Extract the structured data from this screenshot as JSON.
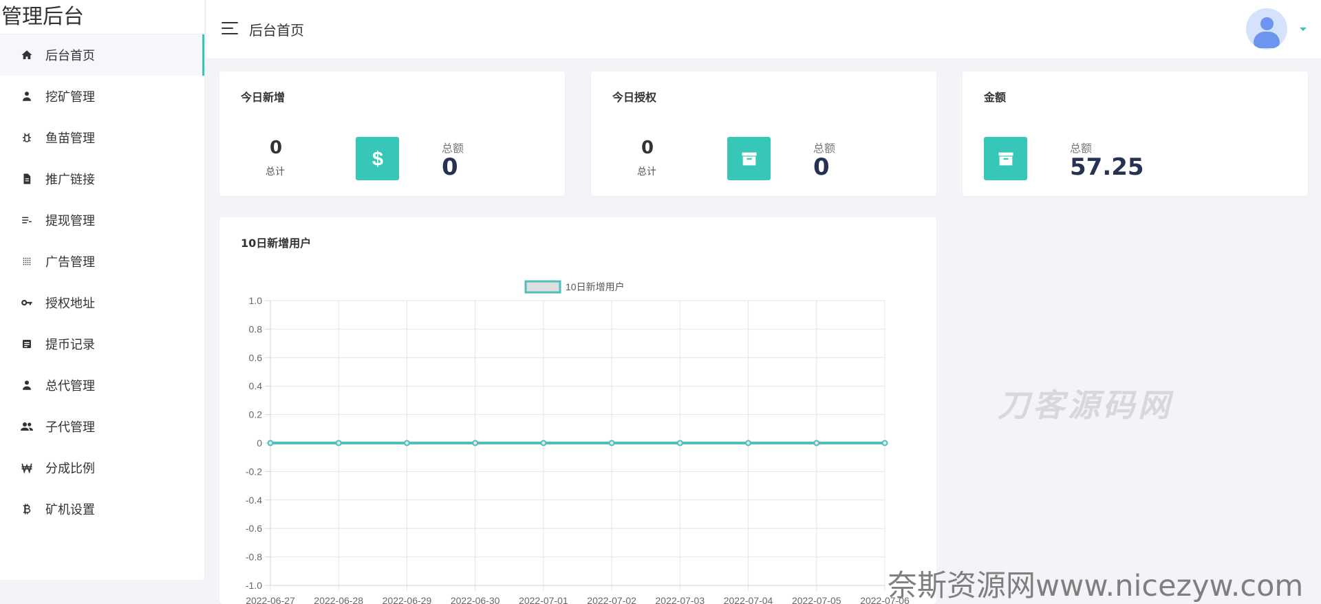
{
  "app": {
    "brand": "管理后台",
    "accent_color": "#38c5b8"
  },
  "sidebar": {
    "items": [
      {
        "label": "后台首页",
        "icon": "home-icon",
        "active": true
      },
      {
        "label": "挖矿管理",
        "icon": "person-icon"
      },
      {
        "label": "鱼苗管理",
        "icon": "bug-icon"
      },
      {
        "label": "推广链接",
        "icon": "document-icon"
      },
      {
        "label": "提现管理",
        "icon": "list-sort-icon"
      },
      {
        "label": "广告管理",
        "icon": "grid-dots-icon"
      },
      {
        "label": "授权地址",
        "icon": "key-icon"
      },
      {
        "label": "提币记录",
        "icon": "note-icon"
      },
      {
        "label": "总代管理",
        "icon": "person-icon"
      },
      {
        "label": "子代管理",
        "icon": "people-icon"
      },
      {
        "label": "分成比例",
        "icon": "currency-won-icon"
      },
      {
        "label": "矿机设置",
        "icon": "bitcoin-icon"
      }
    ]
  },
  "header": {
    "title": "后台首页",
    "menu_icon": "hamburger-menu-icon",
    "avatar_icon": "user-avatar-icon",
    "dropdown_icon": "caret-down-icon"
  },
  "cards": [
    {
      "title": "今日新增",
      "count": "0",
      "count_label": "总计",
      "icon": "dollar-icon",
      "amount_label": "总额",
      "amount": "0"
    },
    {
      "title": "今日授权",
      "count": "0",
      "count_label": "总计",
      "icon": "archive-box-icon",
      "amount_label": "总额",
      "amount": "0"
    },
    {
      "title": "金额",
      "icon": "archive-box-icon",
      "amount_label": "总额",
      "amount": "57.25"
    }
  ],
  "chart_data": {
    "type": "line",
    "title": "10日新增用户",
    "legend": "10日新增用户",
    "legend_position": "top",
    "x": [
      "2022-06-27",
      "2022-06-28",
      "2022-06-29",
      "2022-06-30",
      "2022-07-01",
      "2022-07-02",
      "2022-07-03",
      "2022-07-04",
      "2022-07-05",
      "2022-07-06"
    ],
    "series": [
      {
        "name": "10日新增用户",
        "values": [
          0,
          0,
          0,
          0,
          0,
          0,
          0,
          0,
          0,
          0
        ],
        "color": "#4dbfbc"
      }
    ],
    "ylim": [
      -1.0,
      1.0
    ],
    "yticks": [
      "1.0",
      "0.8",
      "0.6",
      "0.4",
      "0.2",
      "0",
      "-0.2",
      "-0.4",
      "-0.6",
      "-0.8",
      "-1.0"
    ],
    "grid": true
  },
  "watermarks": {
    "center": "刀客源码网",
    "bottom": "奈斯资源网www.nicezyw.com"
  }
}
